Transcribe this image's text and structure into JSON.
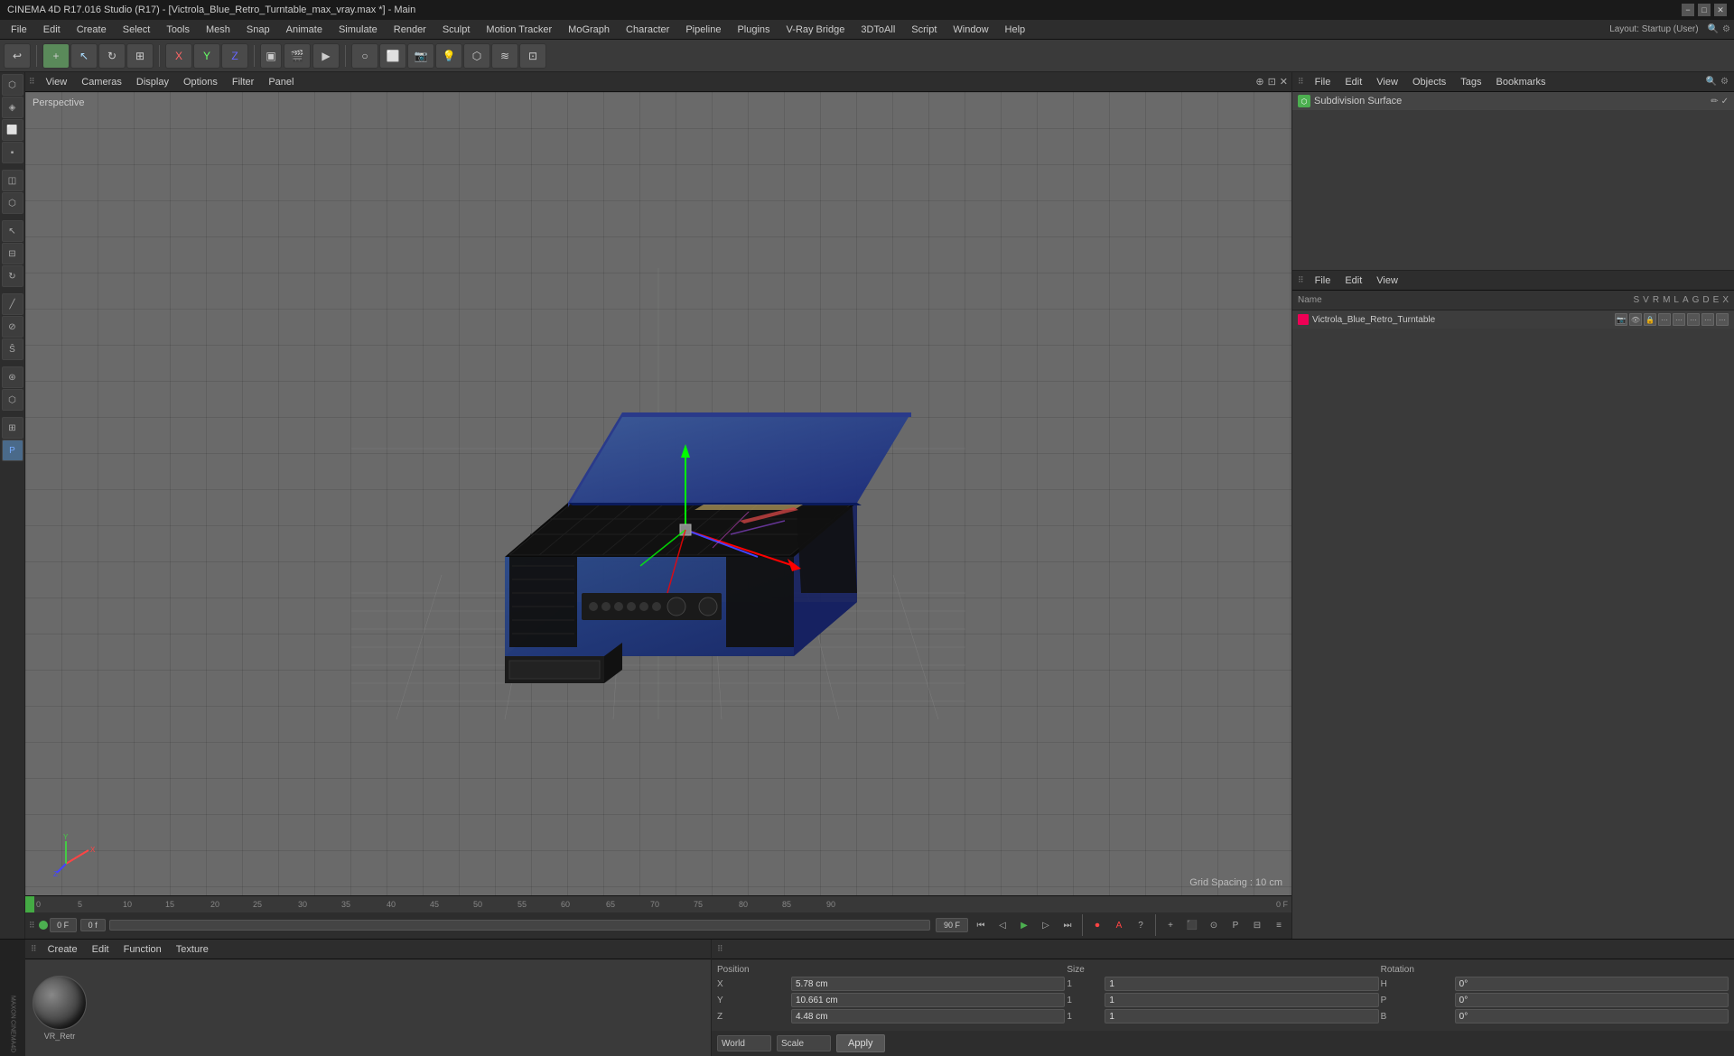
{
  "titlebar": {
    "title": "CINEMA 4D R17.016 Studio (R17) - [Victrola_Blue_Retro_Turntable_max_vray.max *] - Main",
    "minimize": "−",
    "maximize": "□",
    "close": "✕"
  },
  "layout": {
    "label": "Layout:",
    "value": "Startup (User)"
  },
  "menubar": {
    "items": [
      "File",
      "Edit",
      "Create",
      "Select",
      "Tools",
      "Mesh",
      "Snap",
      "Animate",
      "Simulate",
      "Render",
      "Sculpt",
      "Motion Tracker",
      "MoGraph",
      "Character",
      "Pipeline",
      "Plugins",
      "V-Ray Bridge",
      "3DToAll",
      "Script",
      "Window",
      "Help"
    ]
  },
  "viewport": {
    "header_items": [
      "View",
      "Cameras",
      "Display",
      "Options",
      "Filter",
      "Panel"
    ],
    "perspective_label": "Perspective",
    "grid_spacing": "Grid Spacing : 10 cm"
  },
  "right_panel": {
    "top_header": {
      "items": [
        "File",
        "Edit",
        "View",
        "Objects",
        "Tags",
        "Bookmarks"
      ]
    },
    "subdivision_surface": "Subdivision Surface",
    "bottom_header": {
      "items": [
        "File",
        "Edit",
        "View"
      ]
    },
    "columns": {
      "name": "Name",
      "s": "S",
      "v": "V",
      "r": "R",
      "m": "M",
      "l": "L",
      "a": "A",
      "g": "G",
      "d": "D",
      "e": "E",
      "x": "X"
    },
    "object_name": "Victrola_Blue_Retro_Turntable"
  },
  "material_editor": {
    "header_items": [
      "Create",
      "Edit",
      "Function",
      "Texture"
    ],
    "material_name": "VR_Retr"
  },
  "attributes": {
    "position_label": "Position",
    "size_label": "Size",
    "rotation_label": "Rotation",
    "x_pos": "5.78 cm",
    "y_pos": "10.661 cm",
    "z_pos": "4.48 cm",
    "x_size": "1",
    "y_size": "1",
    "z_size": "1",
    "h_rot": "0°",
    "p_rot": "0°",
    "b_rot": "0°",
    "x_label": "X",
    "y_label": "Y",
    "z_label": "Z",
    "h_label": "H",
    "p_label": "P",
    "b_label": "B",
    "coord_system": "World",
    "scale_label": "Scale",
    "apply_label": "Apply"
  },
  "timeline": {
    "frame_start": "0 F",
    "frame_current": "0 F",
    "frame_end": "90 F",
    "marks": [
      "0",
      "5",
      "10",
      "15",
      "20",
      "25",
      "30",
      "35",
      "40",
      "45",
      "50",
      "55",
      "60",
      "65",
      "70",
      "75",
      "80",
      "85",
      "90"
    ],
    "frame_rate": "0 F"
  }
}
